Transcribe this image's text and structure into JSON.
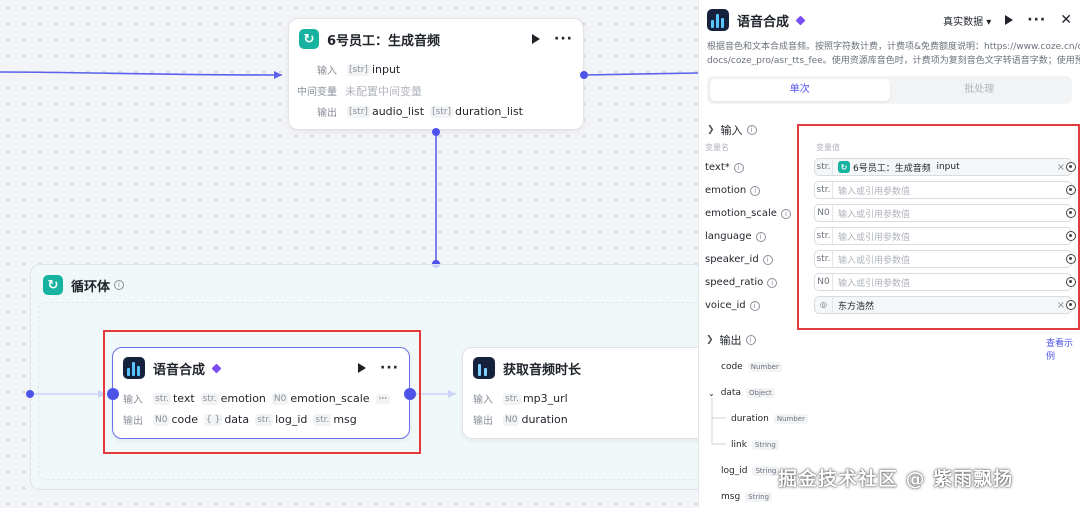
{
  "canvas": {
    "node_top": {
      "title": "6号员工：生成音频",
      "input_label": "输入",
      "input_type": "[str]",
      "input_value": "input",
      "mid_label": "中间变量",
      "mid_value": "未配置中间变量",
      "output_label": "输出",
      "out1_type": "[str]",
      "out1": "audio_list",
      "out2_type": "[str]",
      "out2": "duration_list"
    },
    "loop": {
      "title": "循环体"
    },
    "node_tts": {
      "title": "语音合成",
      "input_label": "输入",
      "inputs": [
        {
          "type": "str.",
          "name": "text"
        },
        {
          "type": "str.",
          "name": "emotion"
        },
        {
          "type": "N0",
          "name": "emotion_scale"
        }
      ],
      "more": "···",
      "output_label": "输出",
      "outputs": [
        {
          "type": "N0",
          "name": "code"
        },
        {
          "type": "{ }",
          "name": "data"
        },
        {
          "type": "str.",
          "name": "log_id"
        },
        {
          "type": "str.",
          "name": "msg"
        }
      ]
    },
    "node_dur": {
      "title": "获取音频时长",
      "input_label": "输入",
      "input_type": "str.",
      "input_name": "mp3_url",
      "output_label": "输出",
      "output_type": "N0",
      "output_name": "duration"
    }
  },
  "panel": {
    "title": "语音合成",
    "data_source": "真实数据",
    "description_line1": "根据音色和文本合成音频。按照字符数计费，计费项&免费额度说明：https://www.coze.cn/open/",
    "description_line2": "docs/coze_pro/asr_tts_fee。使用资源库音色时，计费项为复刻音色文字转语音字数；使用预设...",
    "tab_single": "单次",
    "tab_batch": "批处理",
    "input_section": "输入",
    "col_name": "变量名",
    "col_value": "变量值",
    "params": [
      {
        "name": "text*",
        "type": "str.",
        "value": "6号员工：生成音频",
        "value2": "input",
        "placeholder": ""
      },
      {
        "name": "emotion",
        "type": "str.",
        "value": "",
        "placeholder": "输入或引用参数值"
      },
      {
        "name": "emotion_scale",
        "type": "N0",
        "value": "",
        "placeholder": "输入或引用参数值"
      },
      {
        "name": "language",
        "type": "str.",
        "value": "",
        "placeholder": "输入或引用参数值"
      },
      {
        "name": "speaker_id",
        "type": "str.",
        "value": "",
        "placeholder": "输入或引用参数值"
      },
      {
        "name": "speed_ratio",
        "type": "N0",
        "value": "",
        "placeholder": "输入或引用参数值"
      },
      {
        "name": "voice_id",
        "type": "",
        "value": "东方浩然",
        "placeholder": ""
      }
    ],
    "output_section": "输出",
    "view_example": "查看示例",
    "outputs": [
      {
        "name": "code",
        "type": "Number"
      },
      {
        "name": "data",
        "type": "Object"
      },
      {
        "name": "duration",
        "type": "Number"
      },
      {
        "name": "link",
        "type": "String"
      },
      {
        "name": "log_id",
        "type": "String"
      },
      {
        "name": "msg",
        "type": "String"
      }
    ]
  },
  "watermark": "掘金技术社区 @ 紫雨飘扬",
  "colors": {
    "accent": "#4d53e8",
    "highlight": "#e33b3b",
    "teal": "#16b3a0"
  }
}
